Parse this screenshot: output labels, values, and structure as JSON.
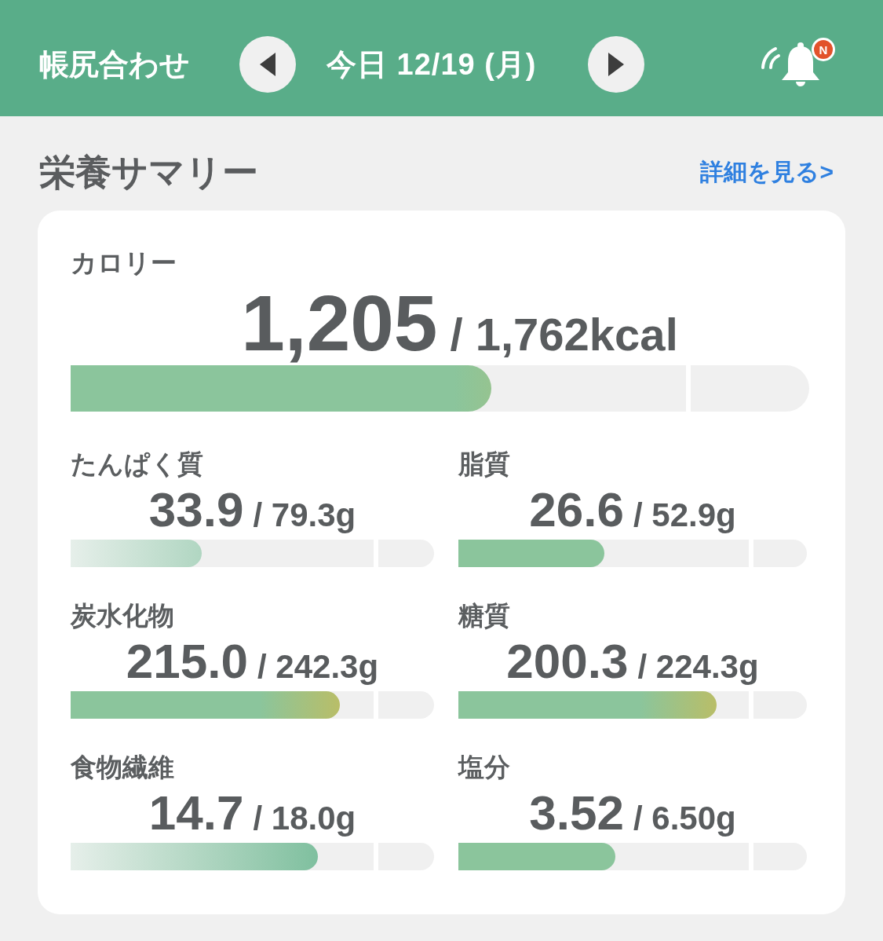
{
  "header": {
    "title": "帳尻合わせ",
    "date": "今日 12/19 (月)",
    "notification_badge": "N"
  },
  "summary": {
    "title": "栄養サマリー",
    "link": "詳細を見る>"
  },
  "calorie": {
    "label": "カロリー",
    "value": "1,205",
    "target": "/ 1,762kcal",
    "level": 0.57,
    "kind": "high"
  },
  "nutrients": [
    {
      "label": "たんぱく質",
      "value": "33.9",
      "target": "/ 79.3g",
      "level": 0.36,
      "kind": "deficient"
    },
    {
      "label": "脂質",
      "value": "26.6",
      "target": "/ 52.9g",
      "level": 0.42,
      "kind": "normal"
    },
    {
      "label": "炭水化物",
      "value": "215.0",
      "target": "/ 242.3g",
      "level": 0.74,
      "kind": "high"
    },
    {
      "label": "糖質",
      "value": "200.3",
      "target": "/ 224.3g",
      "level": 0.74,
      "kind": "high"
    },
    {
      "label": "食物繊維",
      "value": "14.7",
      "target": "/ 18.0g",
      "level": 0.68,
      "kind": "deficient"
    },
    {
      "label": "塩分",
      "value": "3.52",
      "target": "/ 6.50g",
      "level": 0.45,
      "kind": "normal"
    }
  ]
}
